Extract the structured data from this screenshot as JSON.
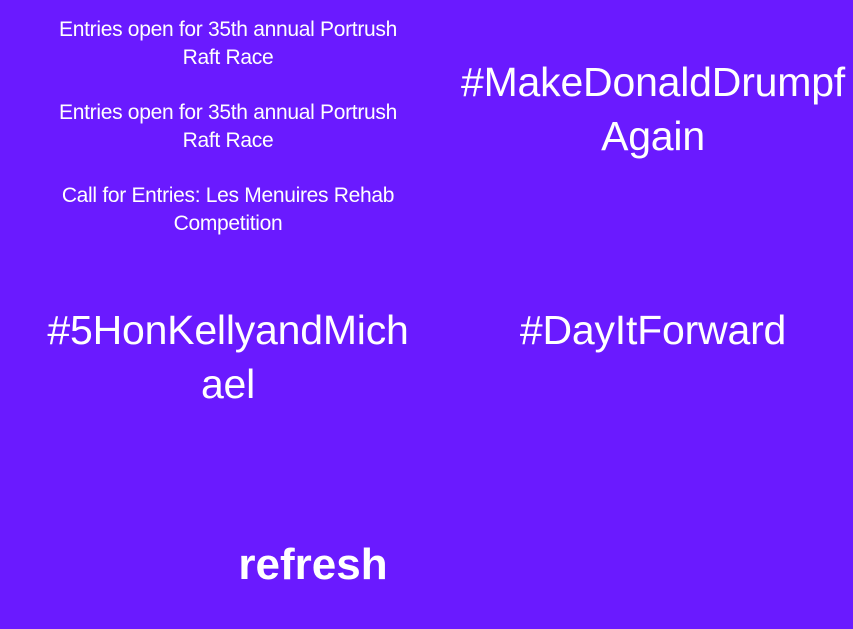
{
  "headlines": [
    "Entries open for 35th annual Portrush Raft Race",
    "Entries open for 35th annual Portrush Raft Race",
    "Call for Entries: Les Menuires Rehab Competition"
  ],
  "hashtags": {
    "top_right": "#MakeDonaldDrumpfAgain",
    "middle_left": "#5HonKellyandMichael",
    "middle_right": "#DayItForward"
  },
  "refresh_label": "refresh",
  "colors": {
    "background": "#6a1aff",
    "text": "#ffffff"
  }
}
